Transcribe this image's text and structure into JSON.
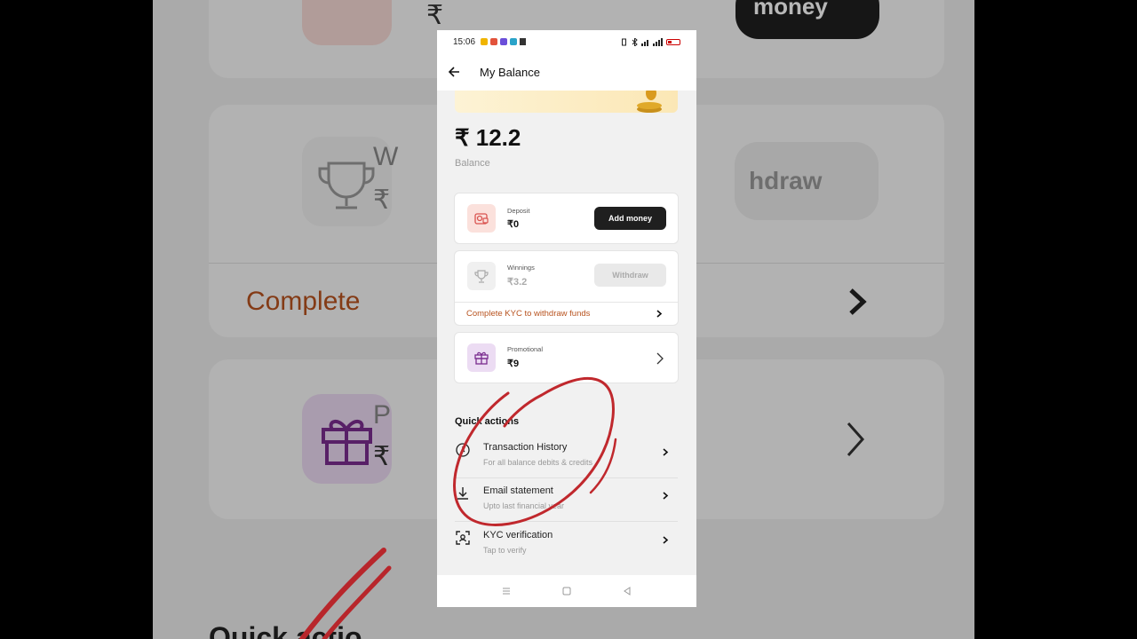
{
  "background": {
    "money_text": "money",
    "withdraw_text": "hdraw",
    "complete_text": "Complete",
    "w_letter": "W",
    "p_letter": "P",
    "rupee": "₹",
    "bottom_text": "Quick actio"
  },
  "status_bar": {
    "time": "15:06",
    "battery": "35"
  },
  "app_bar": {
    "title": "My Balance"
  },
  "balance": {
    "amount": "₹ 12.2",
    "label": "Balance"
  },
  "deposit": {
    "label": "Deposit",
    "value": "₹0",
    "button": "Add money"
  },
  "winnings": {
    "label": "Winnings",
    "value": "₹3.2",
    "button": "Withdraw",
    "kyc_link": "Complete KYC to withdraw funds"
  },
  "promotional": {
    "label": "Promotional",
    "value": "₹9"
  },
  "quick_actions": {
    "title": "Quick actions",
    "items": [
      {
        "title": "Transaction History",
        "subtitle": "For all balance debits & credits",
        "icon": "clock-icon"
      },
      {
        "title": "Email statement",
        "subtitle": "Upto last financial year",
        "icon": "download-icon"
      },
      {
        "title": "KYC verification",
        "subtitle": "Tap to verify",
        "icon": "face-scan-icon"
      }
    ]
  },
  "colors": {
    "accent_orange": "#b8531f",
    "annotation_red": "#c0282d",
    "dark_button": "#1f1f1f"
  }
}
